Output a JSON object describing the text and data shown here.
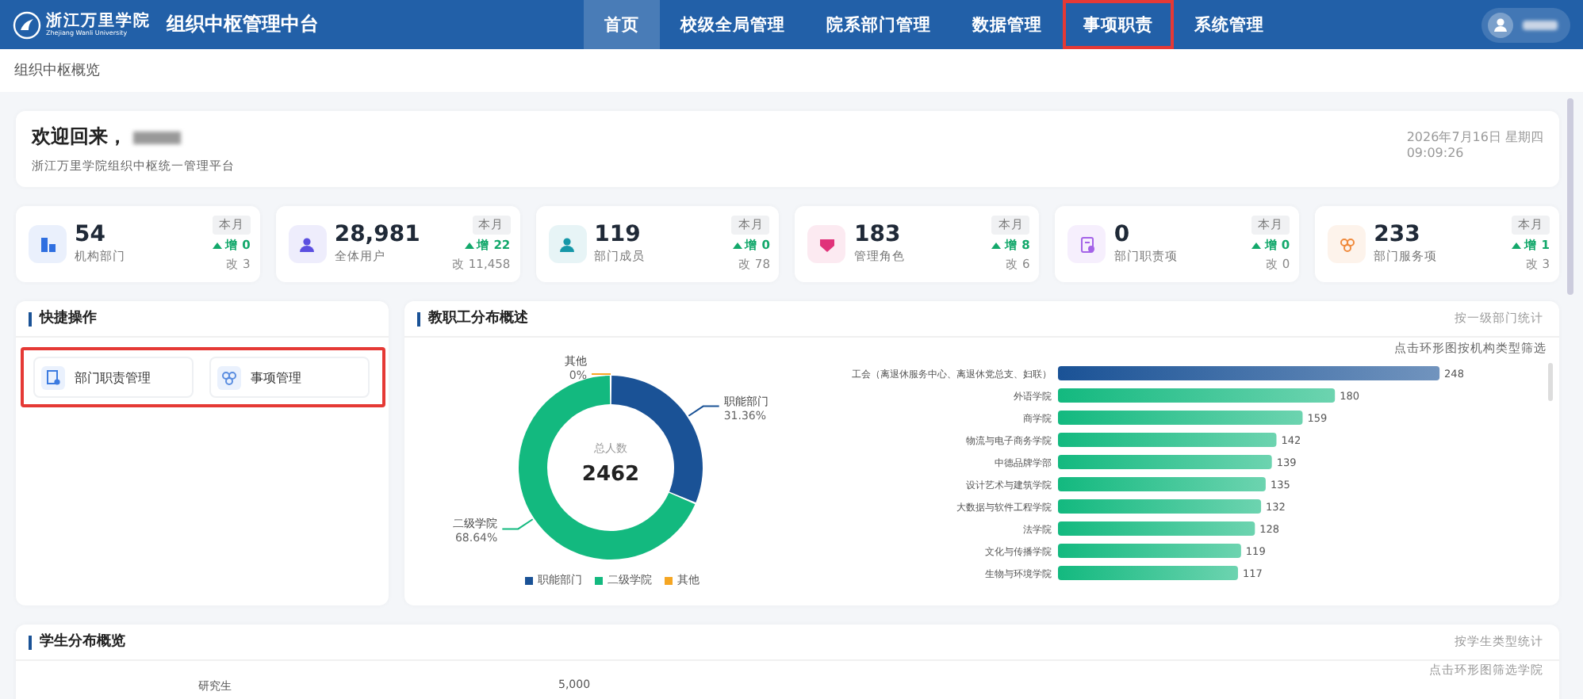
{
  "header": {
    "logo_name": "浙江万里学院",
    "logo_subtitle": "Zhejiang Wanli University",
    "title": "组织中枢管理中台",
    "nav": [
      {
        "label": "首页",
        "selected": true,
        "highlighted": false
      },
      {
        "label": "校级全局管理",
        "selected": false,
        "highlighted": false
      },
      {
        "label": "院系部门管理",
        "selected": false,
        "highlighted": false
      },
      {
        "label": "数据管理",
        "selected": false,
        "highlighted": false
      },
      {
        "label": "事项职责",
        "selected": false,
        "highlighted": true
      },
      {
        "label": "系统管理",
        "selected": false,
        "highlighted": false
      }
    ]
  },
  "breadcrumb": "组织中枢概览",
  "welcome": {
    "greeting": "欢迎回来，",
    "subtitle": "浙江万里学院组织中枢统一管理平台",
    "date": "2026年7月16日 星期四",
    "time": "09:09:26"
  },
  "stats": [
    {
      "value": "54",
      "label": "机构部门",
      "period": "本月",
      "increase": "增 0",
      "changed": "改 3",
      "color": "#2f6fe0"
    },
    {
      "value": "28,981",
      "label": "全体用户",
      "period": "本月",
      "increase": "增 22",
      "changed": "改 11,458",
      "color": "#5b4fe0"
    },
    {
      "value": "119",
      "label": "部门成员",
      "period": "本月",
      "increase": "增 0",
      "changed": "改 78",
      "color": "#1597a8"
    },
    {
      "value": "183",
      "label": "管理角色",
      "period": "本月",
      "increase": "增 8",
      "changed": "改 6",
      "color": "#e0337a"
    },
    {
      "value": "0",
      "label": "部门职责项",
      "period": "本月",
      "increase": "增 0",
      "changed": "改 0",
      "color": "#a463e8"
    },
    {
      "value": "233",
      "label": "部门服务项",
      "period": "本月",
      "increase": "增 1",
      "changed": "改 3",
      "color": "#f08a3c"
    }
  ],
  "quick_actions": {
    "title": "快捷操作",
    "highlighted": true,
    "items": [
      {
        "label": "部门职责管理"
      },
      {
        "label": "事项管理"
      }
    ]
  },
  "staff": {
    "title": "教职工分布概述",
    "filter_label": "按一级部门统计",
    "hint": "点击环形图按机构类型筛选",
    "total_label": "总人数",
    "total": "2462",
    "donut": {
      "chart_data": {
        "type": "donut",
        "categories": [
          "职能部门",
          "二级学院",
          "其他"
        ],
        "values": [
          31.36,
          68.64,
          0
        ],
        "value_labels": [
          "31.36%",
          "68.64%",
          "0%"
        ]
      },
      "legend": [
        {
          "label": "职能部门",
          "color": "#1a5296"
        },
        {
          "label": "二级学院",
          "color": "#13b97f"
        },
        {
          "label": "其他",
          "color": "#f5a623"
        }
      ]
    },
    "bars": {
      "chart_data": {
        "type": "bar",
        "orientation": "horizontal",
        "stacked": true,
        "data_labels": true,
        "categories": [
          "工会（离退休服务中心、离退休党总支、妇联）",
          "外语学院",
          "商学院",
          "物流与电子商务学院",
          "中德品牌学部",
          "设计艺术与建筑学院",
          "大数据与软件工程学院",
          "法学院",
          "文化与传播学院",
          "生物与环境学院"
        ],
        "series": [
          {
            "color": "#1a5296",
            "values": [
              248,
              null,
              null,
              null,
              null,
              null,
              null,
              null,
              null,
              null
            ]
          },
          {
            "color": "#13b97f",
            "values": [
              null,
              180,
              159,
              142,
              139,
              135,
              132,
              128,
              119,
              117
            ]
          }
        ]
      }
    }
  },
  "students": {
    "title": "学生分布概览",
    "filter_label": "按学生类型统计",
    "hint": "点击环形图筛选学院",
    "visible_labels": [
      "研究生",
      "5,000"
    ]
  }
}
